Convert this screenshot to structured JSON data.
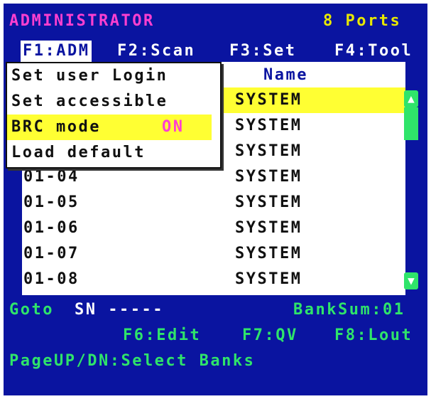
{
  "header": {
    "role": "ADMINISTRATOR",
    "ports": "8 Ports"
  },
  "menubar": [
    {
      "label": "F1:ADM"
    },
    {
      "label": "F2:Scan"
    },
    {
      "label": "F3:Set"
    },
    {
      "label": "F4:Tool"
    }
  ],
  "dropdown": {
    "items": [
      {
        "label": "Set user Login"
      },
      {
        "label": "Set accessible"
      },
      {
        "label": "BRC mode",
        "value": "ON"
      },
      {
        "label": "Load default"
      }
    ]
  },
  "list": {
    "name_header": "Name",
    "rows": [
      {
        "port": "",
        "name": "SYSTEM"
      },
      {
        "port": "",
        "name": "SYSTEM"
      },
      {
        "port": "",
        "name": "SYSTEM"
      },
      {
        "port": "01-04",
        "name": "SYSTEM"
      },
      {
        "port": "01-05",
        "name": "SYSTEM"
      },
      {
        "port": "01-06",
        "name": "SYSTEM"
      },
      {
        "port": "01-07",
        "name": "SYSTEM"
      },
      {
        "port": "01-08",
        "name": "SYSTEM"
      }
    ]
  },
  "footer": {
    "goto_label": "Goto",
    "sn_label": "SN -----",
    "banksum": "BankSum:01",
    "f6": "F6:Edit",
    "f7": "F7:QV",
    "f8": "F8:Lout",
    "pageupdn": "PageUP/DN:Select Banks"
  },
  "icons": {
    "scroll_up": "scroll-up-arrow-icon",
    "scroll_down": "scroll-down-arrow-icon"
  },
  "colors": {
    "background": "#0a14a0",
    "highlight": "#ffff33",
    "accent_green": "#2fe46a",
    "accent_pink": "#ff3fd0",
    "title_pink": "#ff3fd0",
    "ports_yellow": "#e8e800"
  }
}
